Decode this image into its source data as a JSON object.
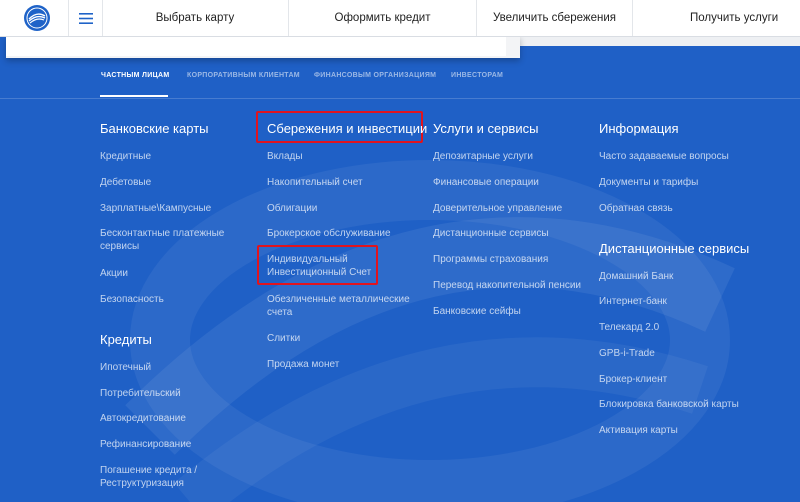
{
  "topnav": {
    "items": [
      "Выбрать карту",
      "Оформить кредит",
      "Увеличить сбережения",
      "Получить услуги"
    ]
  },
  "segments": {
    "tabs": [
      "ЧАСТНЫМ ЛИЦАМ",
      "КОРПОРАТИВНЫМ КЛИЕНТАМ",
      "ФИНАНСОВЫМ ОРГАНИЗАЦИЯМ",
      "ИНВЕСТОРАМ"
    ],
    "active": "ЧАСТНЫМ ЛИЦАМ"
  },
  "columns": {
    "cards": {
      "heading": "Банковские карты",
      "links": [
        "Кредитные",
        "Дебетовые",
        "Зарплатные\\Кампусные",
        "Бесконтактные платежные\nсервисы",
        "Акции",
        "Безопасность"
      ]
    },
    "credits": {
      "heading": "Кредиты",
      "links": [
        "Ипотечный",
        "Потребительский",
        "Автокредитование",
        "Рефинансирование",
        "Погашение кредита /\nРеструктуризация"
      ]
    },
    "savings": {
      "heading": "Сбережения и инвестиции",
      "links": [
        "Вклады",
        "Накопительный счет",
        "Облигации",
        "Брокерское обслуживание",
        "Индивидуальный\nИнвестиционный Счет",
        "Обезличенные металлические\nсчета",
        "Слитки",
        "Продажа монет"
      ]
    },
    "services": {
      "heading": "Услуги и сервисы",
      "links": [
        "Депозитарные услуги",
        "Финансовые операции",
        "Доверительное управление",
        "Дистанционные сервисы",
        "Программы страхования",
        "Перевод накопительной пенсии",
        "Банковские сейфы"
      ]
    },
    "info": {
      "heading": "Информация",
      "links": [
        "Часто задаваемые вопросы",
        "Документы и тарифы",
        "Обратная связь"
      ]
    },
    "remote": {
      "heading": "Дистанционные сервисы",
      "links": [
        "Домашний Банк",
        "Интернет-банк",
        "Телекард 2.0",
        "GPB-i-Trade",
        "Брокер-клиент",
        "Блокировка банковской карты",
        "Активация карты"
      ]
    }
  },
  "colors": {
    "background": "#1f60c6",
    "highlight": "#e0141e"
  },
  "icons": [
    "logo-icon",
    "hamburger-icon"
  ]
}
